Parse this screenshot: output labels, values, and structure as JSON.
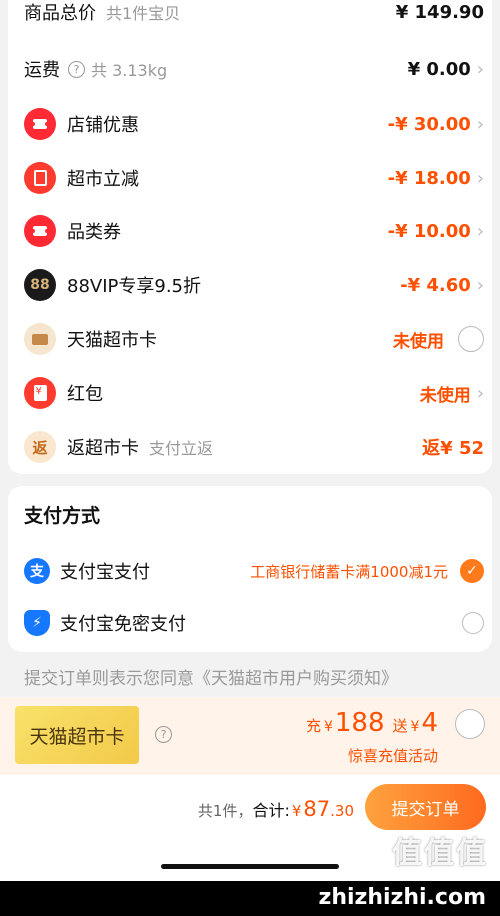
{
  "summary": {
    "goods_total_label": "商品总价",
    "goods_total_sub": "共1件宝贝",
    "goods_total_value": "¥ 149.90",
    "shipping_label": "运费",
    "shipping_sub": "共 3.13kg",
    "shipping_value": "¥ 0.00"
  },
  "discounts": [
    {
      "label": "店铺优惠",
      "value": "-¥ 30.00",
      "icon": "ticket-icon"
    },
    {
      "label": "超市立减",
      "value": "-¥ 18.00",
      "icon": "supermarket-discount-icon"
    },
    {
      "label": "品类券",
      "value": "-¥ 10.00",
      "icon": "ticket-icon"
    },
    {
      "label": "88VIP专享9.5折",
      "value": "-¥ 4.60",
      "icon": "vip88-icon",
      "icon_text": "88"
    }
  ],
  "tmall_card": {
    "label": "天猫超市卡",
    "value": "未使用"
  },
  "red_packet": {
    "label": "红包",
    "value": "未使用"
  },
  "rebate": {
    "label": "返超市卡",
    "sub": "支付立返",
    "value": "返¥ 52",
    "icon_text": "返"
  },
  "payment": {
    "title": "支付方式",
    "alipay_label": "支付宝支付",
    "alipay_promo": "工商银行储蓄卡满1000减1元",
    "alipay_icon_text": "支",
    "nopwd_label": "支付宝免密支付"
  },
  "agreement": "提交订单则表示您同意《天猫超市用户购买须知》",
  "recharge": {
    "card_label": "天猫超市卡",
    "charge_prefix": "充",
    "charge_yen": "¥",
    "charge_amount": "188",
    "gift_prefix": "送",
    "gift_yen": "¥",
    "gift_amount": "4",
    "activity": "惊喜充值活动"
  },
  "footer": {
    "count": "共1件，",
    "total_label": "合计:",
    "yen": "¥",
    "total_int": "87",
    "total_dec": ".30",
    "submit_label": "提交订单"
  },
  "watermark": {
    "logo": "值值值",
    "site": "zhizhizhi.com"
  },
  "colors": {
    "accent": "#ff5000",
    "alipay_blue": "#1677ff",
    "checked": "#ff7a1a"
  }
}
